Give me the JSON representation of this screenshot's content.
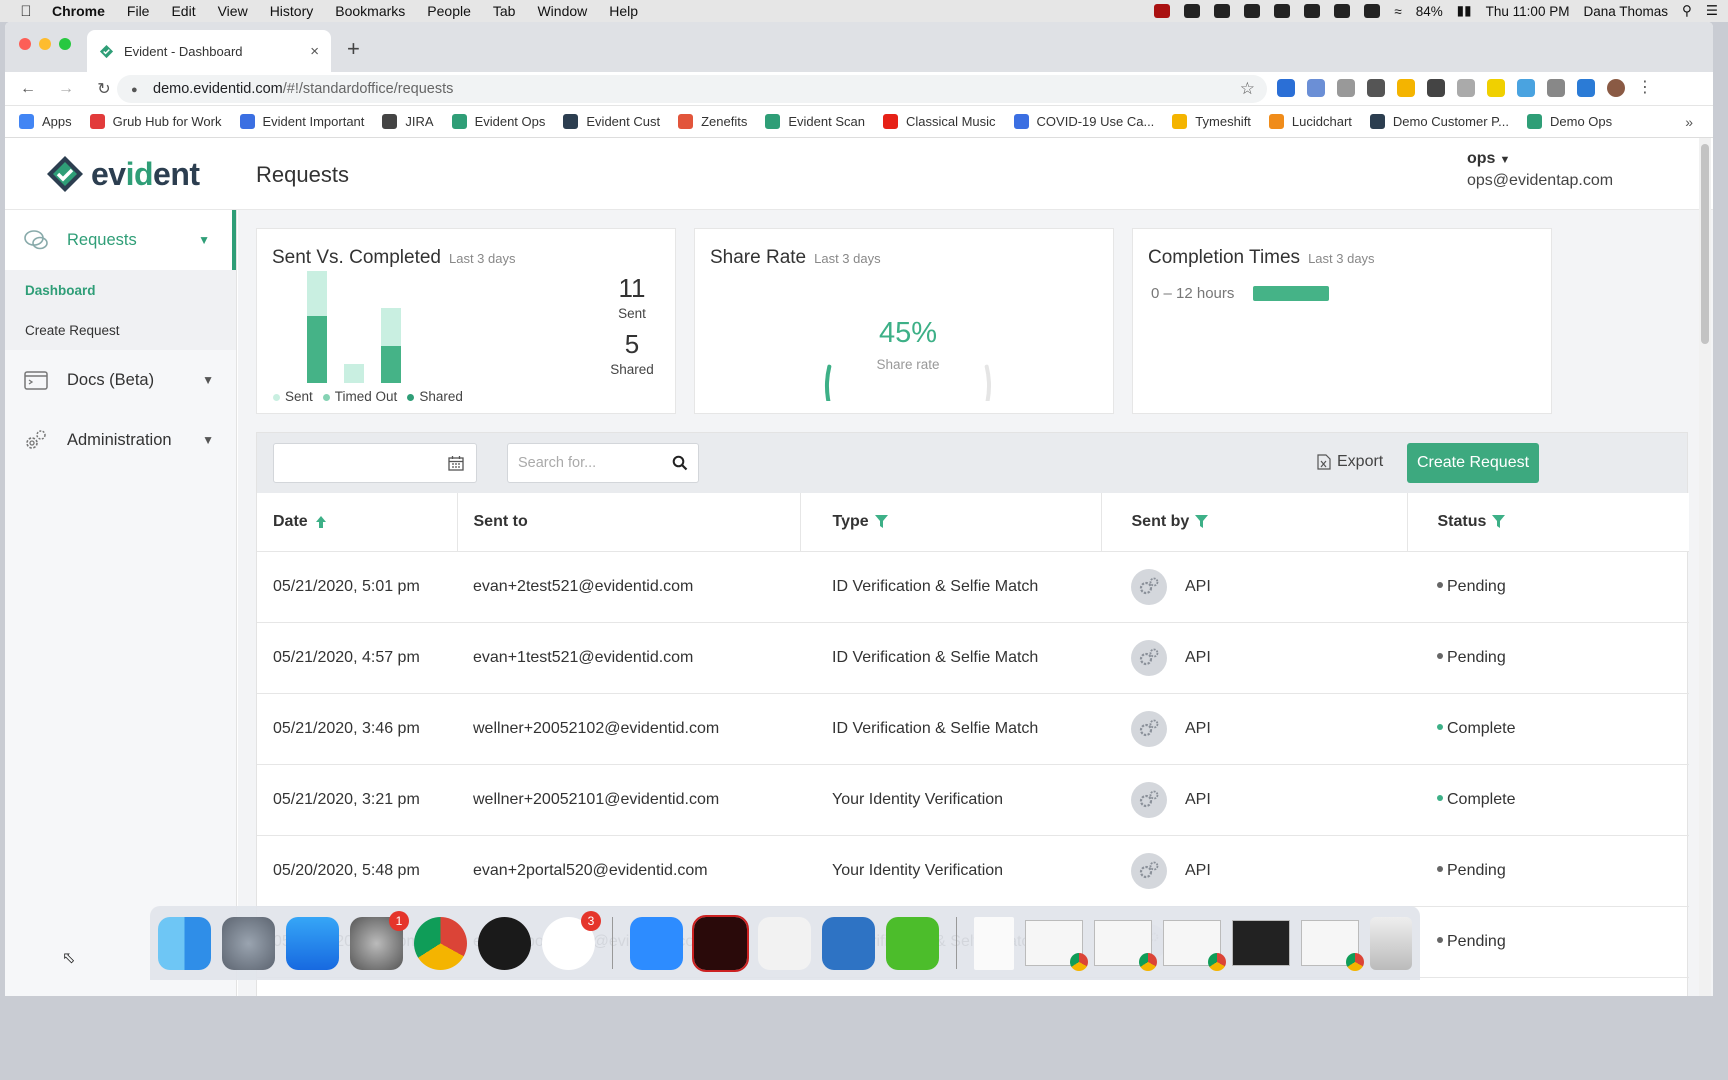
{
  "menubar": {
    "app": "Chrome",
    "items": [
      "File",
      "Edit",
      "View",
      "History",
      "Bookmarks",
      "People",
      "Tab",
      "Window",
      "Help"
    ],
    "battery": "84%",
    "clock": "Thu 11:00 PM",
    "user": "Dana Thomas"
  },
  "browser": {
    "tab_title": "Evident - Dashboard",
    "url_host": "demo.evidentid.com",
    "url_path": "/#!/standardoffice/requests",
    "bookmarks": [
      {
        "label": "Apps",
        "color": "#4285f4"
      },
      {
        "label": "Grub Hub for Work",
        "color": "#e23b3b"
      },
      {
        "label": "Evident Important",
        "color": "#3b6fe2"
      },
      {
        "label": "JIRA",
        "color": "#444444"
      },
      {
        "label": "Evident Ops",
        "color": "#2f9e77"
      },
      {
        "label": "Evident Cust",
        "color": "#2c3e50"
      },
      {
        "label": "Zenefits",
        "color": "#e2553b"
      },
      {
        "label": "Evident Scan",
        "color": "#2f9e77"
      },
      {
        "label": "Classical Music",
        "color": "#e62117"
      },
      {
        "label": "COVID-19 Use Ca...",
        "color": "#3b6fe2"
      },
      {
        "label": "Tymeshift",
        "color": "#f4b400"
      },
      {
        "label": "Lucidchart",
        "color": "#f08c1a"
      },
      {
        "label": "Demo Customer P...",
        "color": "#2c3e50"
      },
      {
        "label": "Demo Ops",
        "color": "#2f9e77"
      }
    ],
    "more": "»"
  },
  "app": {
    "logo": {
      "pre": "ev",
      "accent": "id",
      "post": "ent"
    },
    "page_title": "Requests",
    "user_name": "ops",
    "user_email": "ops@evidentap.com"
  },
  "sidebar": {
    "requests": "Requests",
    "sub": [
      "Dashboard",
      "Create Request"
    ],
    "docs": "Docs (Beta)",
    "admin": "Administration"
  },
  "cards": {
    "sent_vs_completed": {
      "title": "Sent Vs. Completed",
      "range": "Last 3 days",
      "sent_count": "11",
      "sent_label": "Sent",
      "shared_count": "5",
      "shared_label": "Shared",
      "legend": [
        "Sent",
        "Timed Out",
        "Shared"
      ],
      "bars": [
        {
          "light": 6,
          "dark": 9
        },
        {
          "light": 2.5,
          "dark": 0
        },
        {
          "light": 5,
          "dark": 5
        }
      ],
      "bar_max": 15
    },
    "share_rate": {
      "title": "Share Rate",
      "range": "Last 3 days",
      "value": "45%",
      "fraction": 0.45,
      "label": "Share rate"
    },
    "completion": {
      "title": "Completion Times",
      "range": "Last 3 days",
      "bucket": "0 – 12 hours",
      "fraction": 0.28
    }
  },
  "toolbar": {
    "search_placeholder": "Search for...",
    "export": "Export",
    "create": "Create Request"
  },
  "table": {
    "columns": [
      "Date",
      "Sent to",
      "Type",
      "Sent by",
      "Status"
    ],
    "rows": [
      {
        "date": "05/21/2020, 5:01 pm",
        "to": "evan+2test521@evidentid.com",
        "type": "ID Verification & Selfie Match",
        "by": "API",
        "status": "Pending"
      },
      {
        "date": "05/21/2020, 4:57 pm",
        "to": "evan+1test521@evidentid.com",
        "type": "ID Verification & Selfie Match",
        "by": "API",
        "status": "Pending"
      },
      {
        "date": "05/21/2020, 3:46 pm",
        "to": "wellner+20052102@evidentid.com",
        "type": "ID Verification & Selfie Match",
        "by": "API",
        "status": "Complete"
      },
      {
        "date": "05/21/2020, 3:21 pm",
        "to": "wellner+20052101@evidentid.com",
        "type": "Your Identity Verification",
        "by": "API",
        "status": "Complete"
      },
      {
        "date": "05/20/2020, 5:48 pm",
        "to": "evan+2portal520@evidentid.com",
        "type": "Your Identity Verification",
        "by": "API",
        "status": "Pending"
      },
      {
        "date": "05/20/2020, 5:42 pm",
        "to": "evan+1portal520@evidentid.com",
        "type": "ID Verification & Selfie Match",
        "by": "API",
        "status": "Pending"
      }
    ]
  },
  "colors": {
    "accent": "#2f9e77",
    "bar_dark": "#45b387",
    "bar_light": "#c9efe1",
    "pending": "#666666",
    "complete": "#3db087"
  },
  "dock": {
    "badges": {
      "prefs": "1",
      "slack": "3"
    }
  }
}
